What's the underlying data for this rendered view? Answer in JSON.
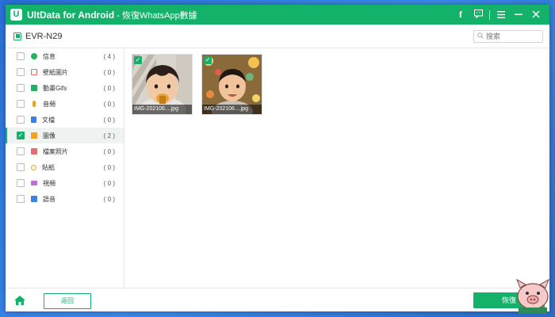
{
  "app": {
    "logo_letter": "U",
    "name": "UltData for Android",
    "subtitle": "- 恢復WhatsApp數據",
    "accent": "#14b16a"
  },
  "titlebar_icons": [
    "facebook-icon",
    "feedback-icon",
    "menu-icon",
    "minimize-icon",
    "close-icon"
  ],
  "device": {
    "name": "EVR-N29"
  },
  "search": {
    "placeholder": "搜索"
  },
  "categories": [
    {
      "label": "信息",
      "count": "( 4 )",
      "checked": false,
      "selected": false,
      "icon": "message-icon",
      "color": "#22b35e"
    },
    {
      "label": "壁紙圖片",
      "count": "( 0 )",
      "checked": false,
      "selected": false,
      "icon": "wallpaper-icon",
      "color": "#e86c6c"
    },
    {
      "label": "動畫Gifs",
      "count": "( 0 )",
      "checked": false,
      "selected": false,
      "icon": "gif-icon",
      "color": "#22b35e"
    },
    {
      "label": "音頻",
      "count": "( 0 )",
      "checked": false,
      "selected": false,
      "icon": "microphone-icon",
      "color": "#f4a11d"
    },
    {
      "label": "文檔",
      "count": "( 0 )",
      "checked": false,
      "selected": false,
      "icon": "document-icon",
      "color": "#3b82e6"
    },
    {
      "label": "圖像",
      "count": "( 2 )",
      "checked": true,
      "selected": true,
      "icon": "image-icon",
      "color": "#f4a11d"
    },
    {
      "label": "檔案照片",
      "count": "( 0 )",
      "checked": false,
      "selected": false,
      "icon": "photo-icon",
      "color": "#e86c6c"
    },
    {
      "label": "貼紙",
      "count": "( 0 )",
      "checked": false,
      "selected": false,
      "icon": "sticker-icon",
      "color": "#f4a11d"
    },
    {
      "label": "視頻",
      "count": "( 0 )",
      "checked": false,
      "selected": false,
      "icon": "video-icon",
      "color": "#c46bd8"
    },
    {
      "label": "語音",
      "count": "( 0 )",
      "checked": false,
      "selected": false,
      "icon": "voice-icon",
      "color": "#3b82e6"
    }
  ],
  "thumbnails": [
    {
      "label": "IMG-202106....jpg",
      "checked": true
    },
    {
      "label": "IMG-202106....jpg",
      "checked": true
    }
  ],
  "footer": {
    "back_label": "返回",
    "recover_label": "恢復"
  }
}
